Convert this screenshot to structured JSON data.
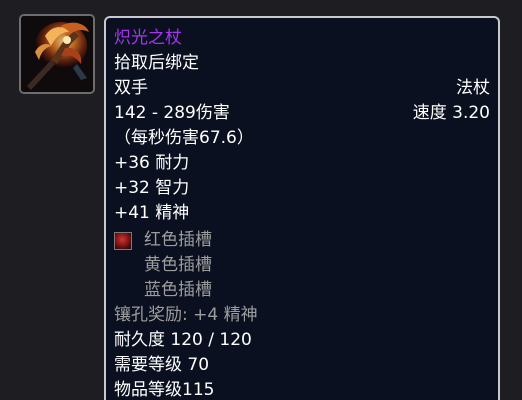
{
  "item": {
    "name": "炽光之杖",
    "bind": "拾取后绑定",
    "slot": "双手",
    "type": "法杖",
    "damage": "142 - 289伤害",
    "speed": "速度 3.20",
    "dps": "（每秒伤害67.6）",
    "stats": [
      "+36 耐力",
      "+32 智力",
      "+41 精神"
    ],
    "sockets": [
      "红色插槽",
      "黄色插槽",
      "蓝色插槽"
    ],
    "socket_bonus": "镶孔奖励: +4 精神",
    "durability": "耐久度 120 / 120",
    "required_level": "需要等级 70",
    "item_level": "物品等级115"
  },
  "colors": {
    "name": "#a335ee",
    "text": "#ffffff",
    "grey": "#9d9d9d",
    "tooltip_bg": "#0a1020",
    "border": "#c9c9d0"
  },
  "icons": {
    "item_icon": "staff-icon",
    "socket_icon": "red-socket-icon"
  }
}
